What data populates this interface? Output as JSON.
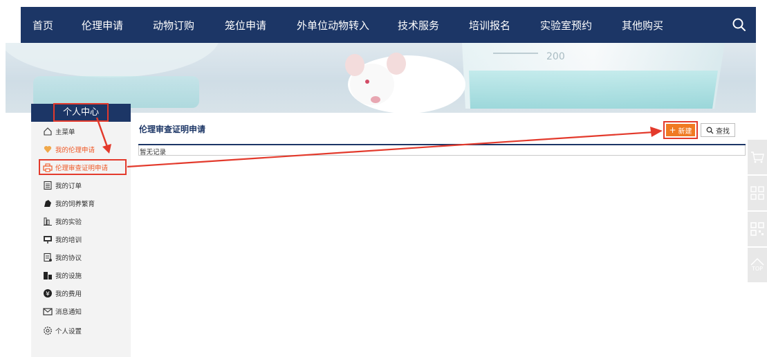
{
  "nav": {
    "items": [
      "首页",
      "伦理申请",
      "动物订购",
      "笼位申请",
      "外单位动物转入",
      "技术服务",
      "培训报名",
      "实验室预约",
      "其他购买"
    ],
    "search_icon": "search-icon"
  },
  "banner": {
    "flask_label": "200"
  },
  "sidebar": {
    "title": "个人中心",
    "items": [
      {
        "label": "主菜单",
        "icon": "home-icon"
      },
      {
        "label": "我的伦理申请",
        "icon": "heart-hand-icon"
      },
      {
        "label": "伦理审查证明申请",
        "icon": "printer-icon"
      },
      {
        "label": "我的订单",
        "icon": "list-icon"
      },
      {
        "label": "我的饲养繁育",
        "icon": "animal-icon"
      },
      {
        "label": "我的实验",
        "icon": "lab-icon"
      },
      {
        "label": "我的培训",
        "icon": "training-icon"
      },
      {
        "label": "我的协议",
        "icon": "document-icon"
      },
      {
        "label": "我的设施",
        "icon": "building-icon"
      },
      {
        "label": "我的费用",
        "icon": "yen-icon"
      },
      {
        "label": "消息通知",
        "icon": "mail-icon"
      },
      {
        "label": "个人设置",
        "icon": "gear-icon"
      }
    ]
  },
  "main": {
    "title": "伦理审查证明申请",
    "new_button": "新建",
    "find_button": "查找",
    "empty_text": "暂无记录"
  },
  "floatbar": {
    "items": [
      "cart-icon",
      "grid-icon",
      "qrcode-icon",
      "top-icon"
    ],
    "top_label": "TOP"
  },
  "colors": {
    "nav_bg": "#1c3666",
    "accent_orange": "#f07a22",
    "highlight_red": "#e33a2c"
  }
}
